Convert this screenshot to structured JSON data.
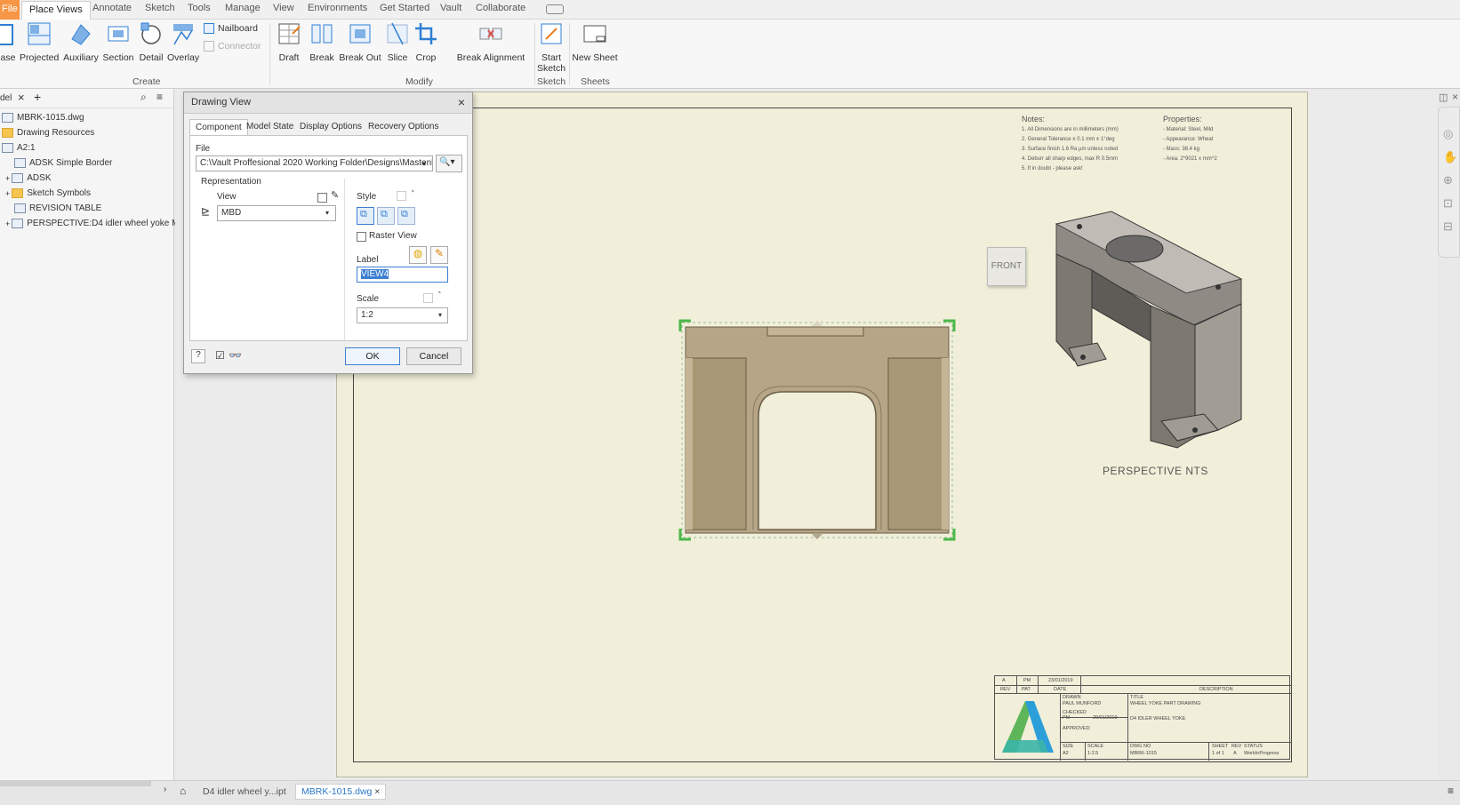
{
  "ribbon_tabs": [
    "File",
    "Place Views",
    "Annotate",
    "Sketch",
    "Tools",
    "Manage",
    "View",
    "Environments",
    "Get Started",
    "Vault",
    "Collaborate"
  ],
  "ribbon": {
    "base_partial": "ase",
    "projected": "Projected",
    "auxiliary": "Auxiliary",
    "section": "Section",
    "detail": "Detail",
    "overlay": "Overlay",
    "nailboard": "Nailboard",
    "connector": "Connector",
    "draft": "Draft",
    "break": "Break",
    "break_out": "Break Out",
    "slice": "Slice",
    "crop": "Crop",
    "break_alignment": "Break Alignment",
    "start_sketch_1": "Start",
    "start_sketch_2": "Sketch",
    "new_sheet": "New Sheet",
    "group_create": "Create",
    "group_modify": "Modify",
    "group_sketch": "Sketch",
    "group_sheets": "Sheets"
  },
  "browser": {
    "tab_label": "del",
    "items": [
      "MBRK-1015.dwg",
      "Drawing Resources",
      "A2:1",
      "ADSK Simple Border",
      "ADSK",
      "Sketch Symbols",
      "REVISION TABLE",
      "PERSPECTIVE:D4 idler wheel yoke MBD"
    ]
  },
  "dialog": {
    "title": "Drawing View",
    "tabs": [
      "Component",
      "Model State",
      "Display Options",
      "Recovery Options"
    ],
    "file_label": "File",
    "file_path": "C:\\Vault Proffesional 2020 Working Folder\\Designs\\Mastenbr",
    "representation_label": "Representation",
    "view_label": "View",
    "view_value": "MBD",
    "style_label": "Style",
    "raster_view_label": "Raster View",
    "label_label": "Label",
    "label_value": "VIEW4",
    "scale_label": "Scale",
    "scale_value": "1:2",
    "ok": "OK",
    "cancel": "Cancel"
  },
  "sheet": {
    "front_badge": "FRONT",
    "perspective_label": "PERSPECTIVE NTS",
    "notes_title": "Notes:",
    "notes": [
      "1.   All Dimensions are in millimeters (mm)",
      "2.   General Tolerance ± 0.1 mm ± 1°deg",
      "3.   Surface finish 1.6 Ra µm unless noted",
      "4.   Deburr all sharp edges, max R 0.5mm",
      "5.   If in doubt - please ask!"
    ],
    "properties_title": "Properties:",
    "properties": [
      "-   Material: Steel, Mild",
      "-   Appearance: Wheat",
      "-   Mass: 38.4 kg",
      "-   Area: 2*9021 x mm^2"
    ]
  },
  "title_block": {
    "rev_row": [
      "A",
      "PM",
      "23/01/2019"
    ],
    "rev_header": [
      "REV",
      "PAT",
      "DATE",
      "DESCRIPTION"
    ],
    "drawn_label": "DRAWN",
    "drawn_by": "PAUL MUNFORD",
    "checked_label": "CHECKED",
    "checked_by": "PM",
    "checked_date": "29/01/2019",
    "approved_label": "APPROVED",
    "title_label": "TITLE",
    "title_1": "WHEEL YOKE PART DRAWING",
    "title_2": "D4 IDLER WHEEL YOKE",
    "size_label": "SIZE",
    "size": "A2",
    "scale_label": "SCALE",
    "scale": "1:2.5",
    "dwg_label": "DWG NO",
    "dwg": "MBRK-1015",
    "sheet_label": "SHEET",
    "sheet": "1 of 1",
    "rev_label": "REV",
    "rev": "A",
    "status_label": "STATUS",
    "status": "WorkInProgress"
  },
  "bottom_tabs": [
    "D4 idler wheel y...ipt",
    "MBRK-1015.dwg"
  ],
  "colors": {
    "sheet_bg": "#f1efd9",
    "part": "#b6a587",
    "accent": "#2a78c8",
    "selection": "#4cb84a"
  }
}
